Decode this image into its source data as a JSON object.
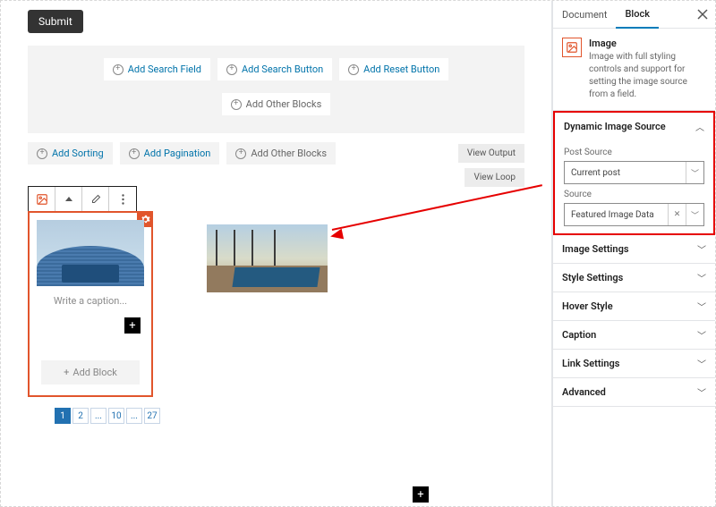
{
  "submit_label": "Submit",
  "panel1": {
    "add_search_field": "Add Search Field",
    "add_search_button": "Add Search Button",
    "add_reset_button": "Add Reset Button",
    "add_other_blocks": "Add Other Blocks"
  },
  "row2": {
    "add_sorting": "Add Sorting",
    "add_pagination": "Add Pagination",
    "add_other_blocks": "Add Other Blocks",
    "view_output": "View Output"
  },
  "view_loop": "View Loop",
  "caption_placeholder": "Write a caption...",
  "add_block": "Add Block",
  "pager": [
    "1",
    "2",
    "...",
    "10",
    "...",
    "27"
  ],
  "sidebar": {
    "tabs": {
      "document": "Document",
      "block": "Block"
    },
    "block_title": "Image",
    "block_desc": "Image with full styling controls and support for setting the image source from a field.",
    "dynamic": {
      "title": "Dynamic Image Source",
      "post_source_label": "Post Source",
      "post_source_value": "Current post",
      "source_label": "Source",
      "source_value": "Featured Image Data"
    },
    "sections": {
      "image_settings": "Image Settings",
      "style_settings": "Style Settings",
      "hover_style": "Hover Style",
      "caption": "Caption",
      "link_settings": "Link Settings",
      "advanced": "Advanced"
    }
  }
}
